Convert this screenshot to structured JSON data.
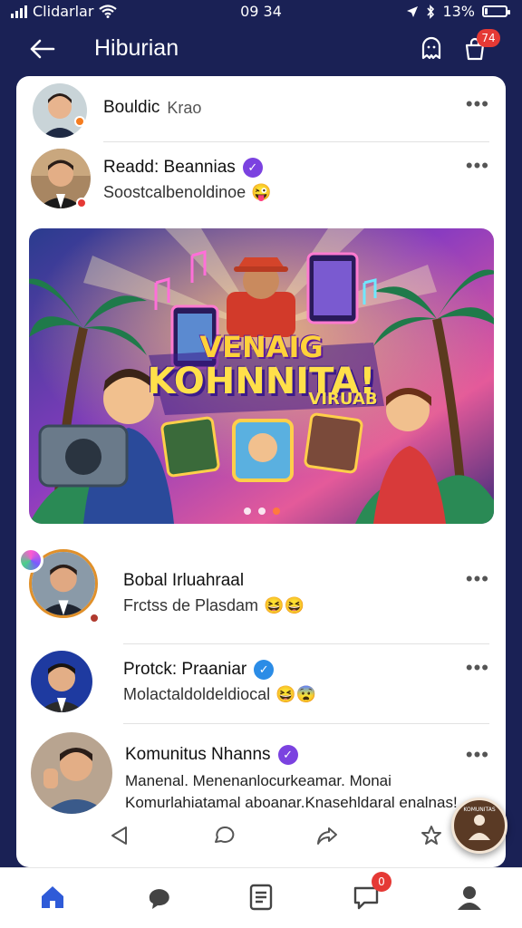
{
  "status_bar": {
    "carrier": "Clidarlar",
    "time": "09 34",
    "battery": "13%",
    "battery_level": 0.13
  },
  "header": {
    "title": "Hiburian",
    "notification_count": "74"
  },
  "posts": [
    {
      "name": "Bouldic",
      "handle": "Krao",
      "status_color": "#f57c1f"
    },
    {
      "name": "Readd: Beannias",
      "subtitle": "Soostcalbenoldinoe",
      "emoji": "😜",
      "verified_color": "#7b42e0",
      "status_color": "#e53935"
    },
    {
      "name": "Bobal Irluahraal",
      "subtitle": "Frctss de Plasdam",
      "emoji": "😆😆",
      "status_color": "#b03a2e"
    },
    {
      "name": "Protck: Praaniar",
      "subtitle": "Molactaldoldeldiocal",
      "emoji": "😆😨",
      "verified_color": "#2b8ce6"
    },
    {
      "name": "Komunitus Nhanns",
      "verified_color": "#7b42e0",
      "text_line1": "Manenal. Menenanlocurkeamar. Monai",
      "text_line2": "Komurlahiatamal aboanar.Knasehldaral enalnas!"
    }
  ],
  "banner": {
    "title_line1": "VENAIG",
    "title_line2": "KOHNNITA!",
    "title_line3": "VIRUAB",
    "active_slide": 3,
    "slide_count": 3
  },
  "fab": {
    "label": "KOMUNITAS"
  },
  "bottom_nav": {
    "active": "home",
    "messages_badge": "0",
    "accent_color": "#2f5bd8"
  }
}
